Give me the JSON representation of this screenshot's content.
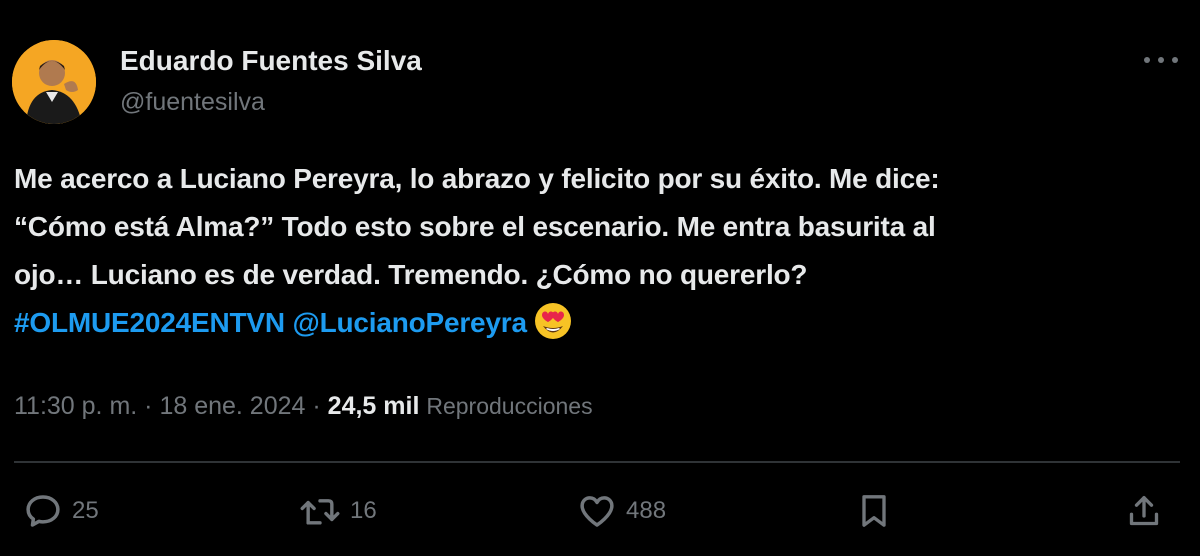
{
  "author": {
    "display_name": "Eduardo Fuentes Silva",
    "handle": "@fuentesilva",
    "avatar_bg": "#f5a623"
  },
  "tweet": {
    "lines": [
      "Me acerco a Luciano Pereyra, lo abrazo y felicito por su éxito. Me dice:",
      "“Cómo está Alma?” Todo esto sobre el escenario. Me entra basurita al",
      "ojo… Luciano es de verdad. Tremendo. ¿Cómo no quererlo?"
    ],
    "hashtag": "#OLMUE2024ENTVN",
    "mention": "@LucianoPereyra",
    "emoji": "smiling-face-with-heart-eyes",
    "link_color": "#1d9bf0"
  },
  "meta": {
    "time": "11:30 p. m.",
    "separator": "·",
    "date": "18 ene. 2024",
    "views_count": "24,5 mil",
    "views_label": "Reproducciones"
  },
  "actions": {
    "replies": "25",
    "retweets": "16",
    "likes": "488"
  },
  "icons": {
    "more": "more-dots-icon",
    "reply": "reply-bubble-icon",
    "retweet": "retweet-icon",
    "like": "heart-icon",
    "bookmark": "bookmark-icon",
    "share": "share-upload-icon"
  }
}
